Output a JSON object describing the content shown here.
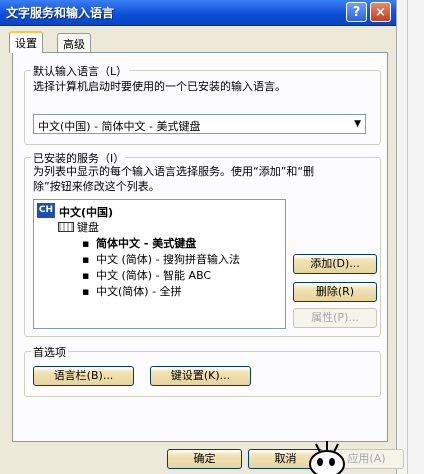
{
  "window": {
    "title": "文字服务和输入语言"
  },
  "titlebar_buttons": {
    "help": "?",
    "close": "×"
  },
  "tabs": [
    {
      "label": "设置",
      "active": true
    },
    {
      "label": "高级",
      "active": false
    }
  ],
  "default_language": {
    "group_label": "默认输入语言（L）",
    "description": "选择计算机启动时要使用的一个已安装的输入语言。",
    "selected": "中文(中国) - 简体中文 - 美式键盘",
    "arrow": "▼"
  },
  "installed_services": {
    "group_label": "已安装的服务（I）",
    "description_line1": "为列表中显示的每个输入语言选择服务。使用“添加”和“删",
    "description_line2": "除”按钮来修改这个列表。",
    "ch_icon": "CH",
    "language": "中文(中国)",
    "keyboard_label": "键盘",
    "services": [
      {
        "label": "简体中文 - 美式键盘",
        "selected": true
      },
      {
        "label": "中文 (简体) - 搜狗拼音输入法",
        "selected": false
      },
      {
        "label": "中文 (简体) - 智能 ABC",
        "selected": false
      },
      {
        "label": "中文(简体) - 全拼",
        "selected": false
      }
    ],
    "bullet": "▪",
    "buttons": {
      "add": "添加(D)...",
      "remove": "删除(R)",
      "properties": "属性(P)..."
    }
  },
  "preferences": {
    "group_label": "首选项",
    "language_bar": "语言栏(B)...",
    "key_settings": "键设置(K)..."
  },
  "dialog_buttons": {
    "ok": "确定",
    "cancel": "取消",
    "apply": "应用(A)"
  }
}
